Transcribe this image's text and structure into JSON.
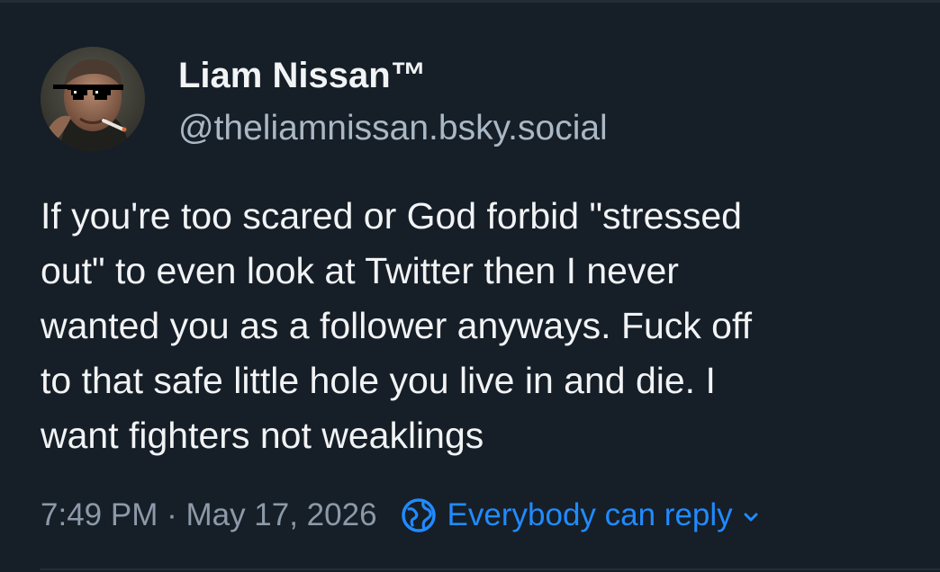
{
  "post": {
    "author": {
      "display_name": "Liam Nissan™",
      "handle": "@theliamnissan.bsky.social",
      "avatar_icon": "avatar-photo-icon"
    },
    "text_lines": [
      "If you're too scared or God forbid \"stressed",
      "out\" to even look at Twitter then I never",
      "wanted you as a follower anyways. Fuck off",
      "to that safe little hole you live in and die. I",
      "want fighters not weaklings"
    ],
    "timestamp": "7:49 PM · May 17, 2026",
    "reply_setting": {
      "label": "Everybody can reply",
      "icon": "globe-icon",
      "chevron_icon": "chevron-down-icon"
    }
  },
  "colors": {
    "background": "#161e27",
    "primary_text": "#f1f3f5",
    "secondary_text": "#aab8c5",
    "meta_text": "#8c99a8",
    "accent": "#208bfe"
  }
}
